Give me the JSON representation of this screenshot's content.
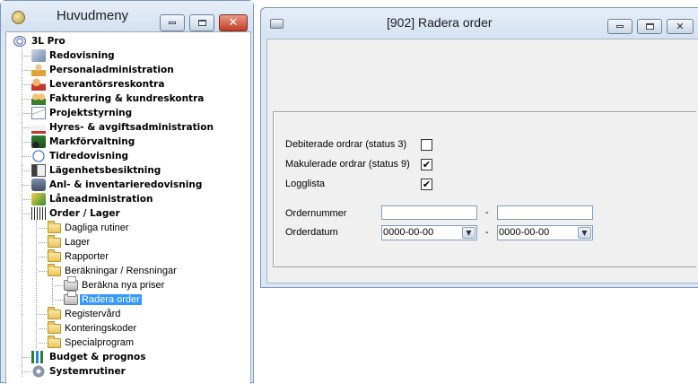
{
  "left_window": {
    "title": "Huvudmeny",
    "root": "3L Pro",
    "modules": [
      {
        "label": "Redovisning",
        "icon": "ledger-icon"
      },
      {
        "label": "Personaladministration",
        "icon": "person-icon"
      },
      {
        "label": "Leverantörsreskontra",
        "icon": "supplier-icon"
      },
      {
        "label": "Fakturering & kundreskontra",
        "icon": "customers-icon"
      },
      {
        "label": "Projektstyrning",
        "icon": "project-chart-icon"
      },
      {
        "label": "Hyres- & avgiftsadministration",
        "icon": "house-icon"
      },
      {
        "label": "Markförvaltning",
        "icon": "tractor-icon"
      },
      {
        "label": "Tidredovisning",
        "icon": "clock-icon"
      },
      {
        "label": "Lägenhetsbesiktning",
        "icon": "door-icon"
      },
      {
        "label": "Anl- & inventarieredovisning",
        "icon": "inventory-icon"
      },
      {
        "label": "Låneadministration",
        "icon": "loan-icon"
      },
      {
        "label": "Order / Lager",
        "icon": "barcode-icon"
      }
    ],
    "order_children": [
      {
        "label": "Dagliga rutiner"
      },
      {
        "label": "Lager"
      },
      {
        "label": "Rapporter"
      },
      {
        "label": "Beräkningar / Rensningar"
      }
    ],
    "calc_children": [
      {
        "label": "Beräkna nya priser"
      },
      {
        "label": "Radera order"
      }
    ],
    "order_children_after": [
      {
        "label": "Registervård"
      },
      {
        "label": "Konteringskoder"
      },
      {
        "label": "Specialprogram"
      }
    ],
    "bottom_modules": [
      {
        "label": "Budget & prognos",
        "icon": "bar-chart-icon"
      },
      {
        "label": "Systemrutiner",
        "icon": "gear-icon"
      }
    ]
  },
  "right_window": {
    "title": "[902]  Radera order",
    "debiterade_label": "Debiterade ordrar (status 3)",
    "debiterade_checked": false,
    "makulerade_label": "Makulerade ordrar (status 9)",
    "makulerade_checked": true,
    "logglista_label": "Logglista",
    "logglista_checked": true,
    "ordernummer_label": "Ordernummer",
    "ordernummer_from": "",
    "ordernummer_to": "",
    "orderdatum_label": "Orderdatum",
    "orderdatum_from": "0000-00-00",
    "orderdatum_to": "0000-00-00",
    "range_separator": "-"
  },
  "colors": {
    "selection": "#3399ff",
    "window_frame": "#dbe7f5",
    "close_button": "#c43b22"
  }
}
